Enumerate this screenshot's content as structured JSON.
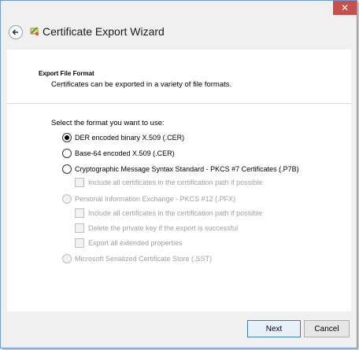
{
  "window": {
    "title": "Certificate Export Wizard",
    "close_glyph": "✕"
  },
  "header": {
    "title": "Export File Format",
    "description": "Certificates can be exported in a variety of file formats."
  },
  "body": {
    "prompt": "Select the format you want to use:",
    "options": [
      {
        "label": "DER encoded binary X.509 (.CER)",
        "checked": true,
        "enabled": true
      },
      {
        "label": "Base-64 encoded X.509 (.CER)",
        "checked": false,
        "enabled": true
      },
      {
        "label": "Cryptographic Message Syntax Standard - PKCS #7 Certificates (.P7B)",
        "checked": false,
        "enabled": true
      },
      {
        "label": "Personal Information Exchange - PKCS #12 (.PFX)",
        "checked": false,
        "enabled": false
      },
      {
        "label": "Microsoft Serialized Certificate Store (.SST)",
        "checked": false,
        "enabled": false
      }
    ],
    "p7b_suboptions": [
      {
        "label": "Include all certificates in the certification path if possible",
        "enabled": false
      }
    ],
    "pfx_suboptions": [
      {
        "label": "Include all certificates in the certification path if possible",
        "enabled": false
      },
      {
        "label": "Delete the private key if the export is successful",
        "enabled": false
      },
      {
        "label": "Export all extended properties",
        "enabled": false
      }
    ]
  },
  "footer": {
    "next_label": "Next",
    "cancel_label": "Cancel"
  }
}
